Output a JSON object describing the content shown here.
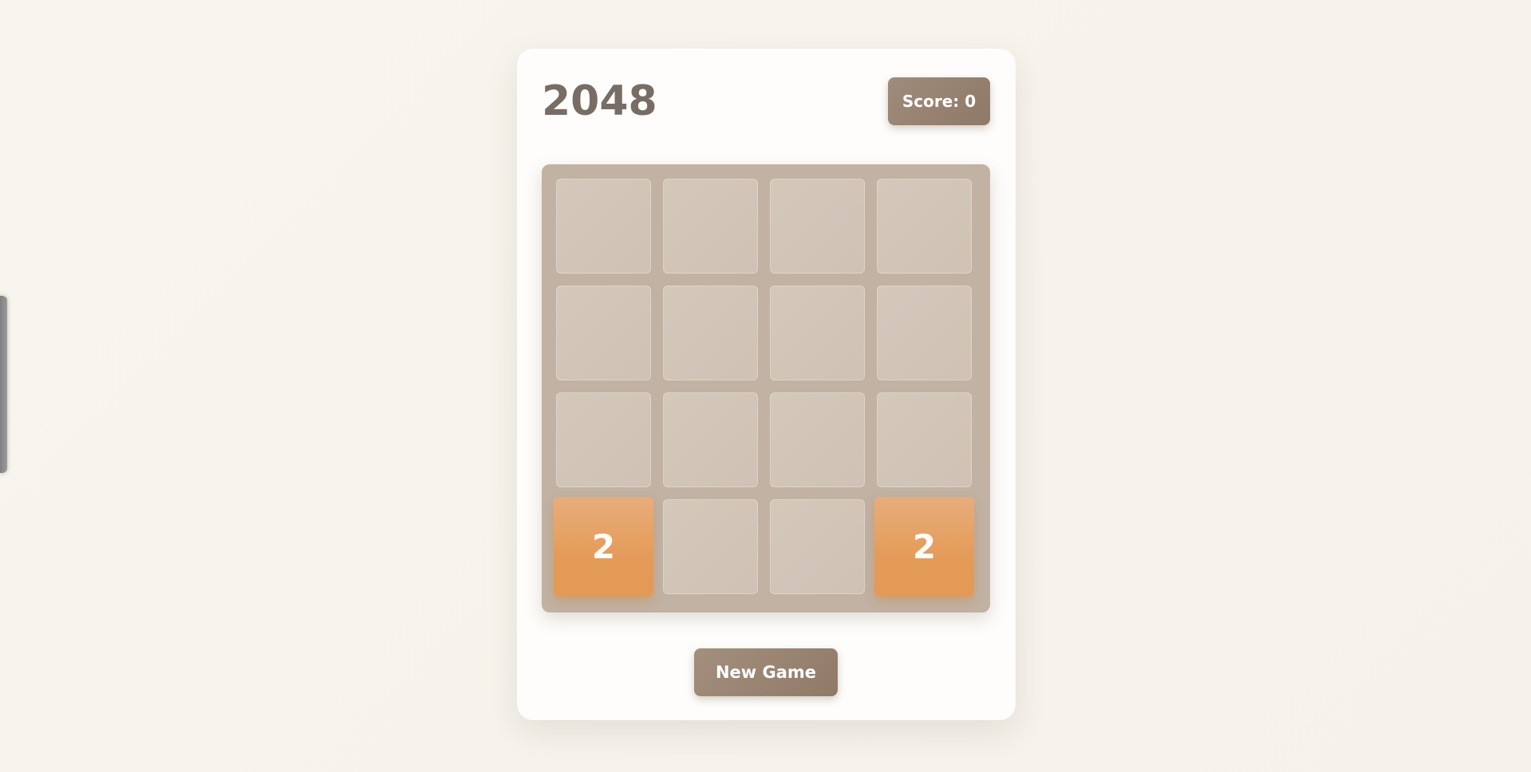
{
  "game": {
    "title": "2048",
    "score_label": "Score: 0",
    "new_game_label": "New Game"
  },
  "board": {
    "size": 4,
    "tiles": [
      [
        null,
        null,
        null,
        null
      ],
      [
        null,
        null,
        null,
        null
      ],
      [
        null,
        null,
        null,
        null
      ],
      [
        "2",
        null,
        null,
        "2"
      ]
    ]
  },
  "colors": {
    "background": "#f6f2ec",
    "card": "#fefdfb",
    "title": "#776d64",
    "board": "#c1b2a3",
    "empty_cell": "#d2c6b9",
    "tile_2": "#e49b59",
    "button": "#9a8573"
  }
}
